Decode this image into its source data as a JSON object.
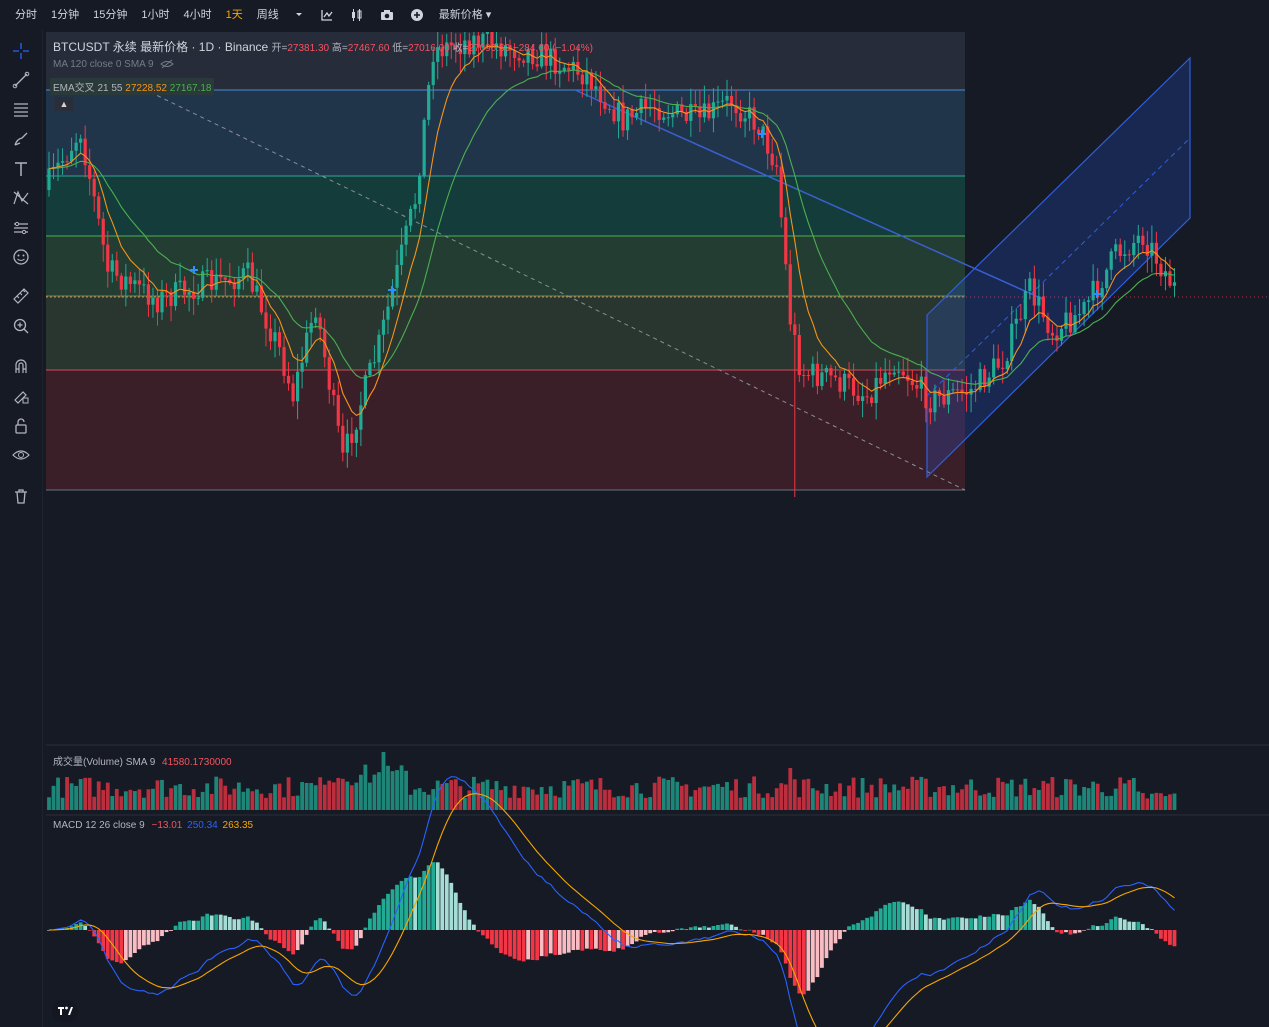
{
  "toolbar": {
    "intervals": [
      "分时",
      "1分钟",
      "15分钟",
      "1小时",
      "4小时",
      "1天",
      "周线"
    ],
    "active_interval": "1天",
    "price_type": "最新价格",
    "icons": [
      "chevron-down-icon",
      "indicators-icon",
      "candle-style-icon",
      "camera-icon",
      "add-icon"
    ]
  },
  "sidebar": {
    "tools": [
      "crosshair-icon",
      "trendline-icon",
      "fib-lines-icon",
      "brush-icon",
      "text-icon",
      "pattern-icon",
      "forecast-icon",
      "emoji-icon",
      "ruler-icon",
      "zoom-icon",
      "magnet-icon",
      "lock-drawing-icon",
      "lock-icon",
      "eye-icon",
      "trash-icon"
    ]
  },
  "legend": {
    "symbol": "BTCUSDT 永续 最新价格",
    "interval": "1D",
    "exchange": "Binance",
    "open_label": "开=",
    "open": "27381.30",
    "high_label": "高=",
    "high": "27467.60",
    "low_label": "低=",
    "low": "27016.00",
    "close_label": "收=",
    "close": "27096.60",
    "change": "−284.60 (−1.04%)",
    "ma": "MA 120 close 0 SMA 9",
    "ema_label": "EMA交叉 21 55",
    "ema_fast": "27228.52",
    "ema_slow": "27167.18",
    "volume_label": "成交量(Volume) SMA 9",
    "volume_value": "41580.1730000",
    "macd_label": "MACD 12 26 close 9",
    "macd_hist": "−13.01",
    "macd_line": "250.34",
    "macd_signal": "263.35"
  },
  "colors": {
    "background": "#161a25",
    "up": "#22ab94",
    "down": "#f23645",
    "ema_fast": "#f7931a",
    "ema_slow": "#4caf50",
    "macd": "#2962ff",
    "signal": "#f7a600",
    "active_interval": "#f7a600",
    "channel": "#2962ff"
  },
  "chart_data": {
    "type": "candlestick",
    "symbol": "BTCUSDT",
    "interval": "1D",
    "last": {
      "open": 27381.3,
      "high": 27467.6,
      "low": 27016.0,
      "close": 27096.6,
      "change": -284.6,
      "change_pct": -1.04
    },
    "ema": {
      "fast_length": 21,
      "slow_length": 55,
      "fast_value": 27228.52,
      "slow_value": 27167.18
    },
    "volume": {
      "sma_length": 9,
      "last_value": 41580.173
    },
    "macd": {
      "fast": 12,
      "slow": 26,
      "signal": 9,
      "histogram": -13.01,
      "macd": 250.34,
      "signal_value": 263.35
    },
    "overlays": [
      "fibonacci-retracement",
      "dashed-trendline",
      "trendline",
      "parallel-channel"
    ],
    "grid": false
  }
}
